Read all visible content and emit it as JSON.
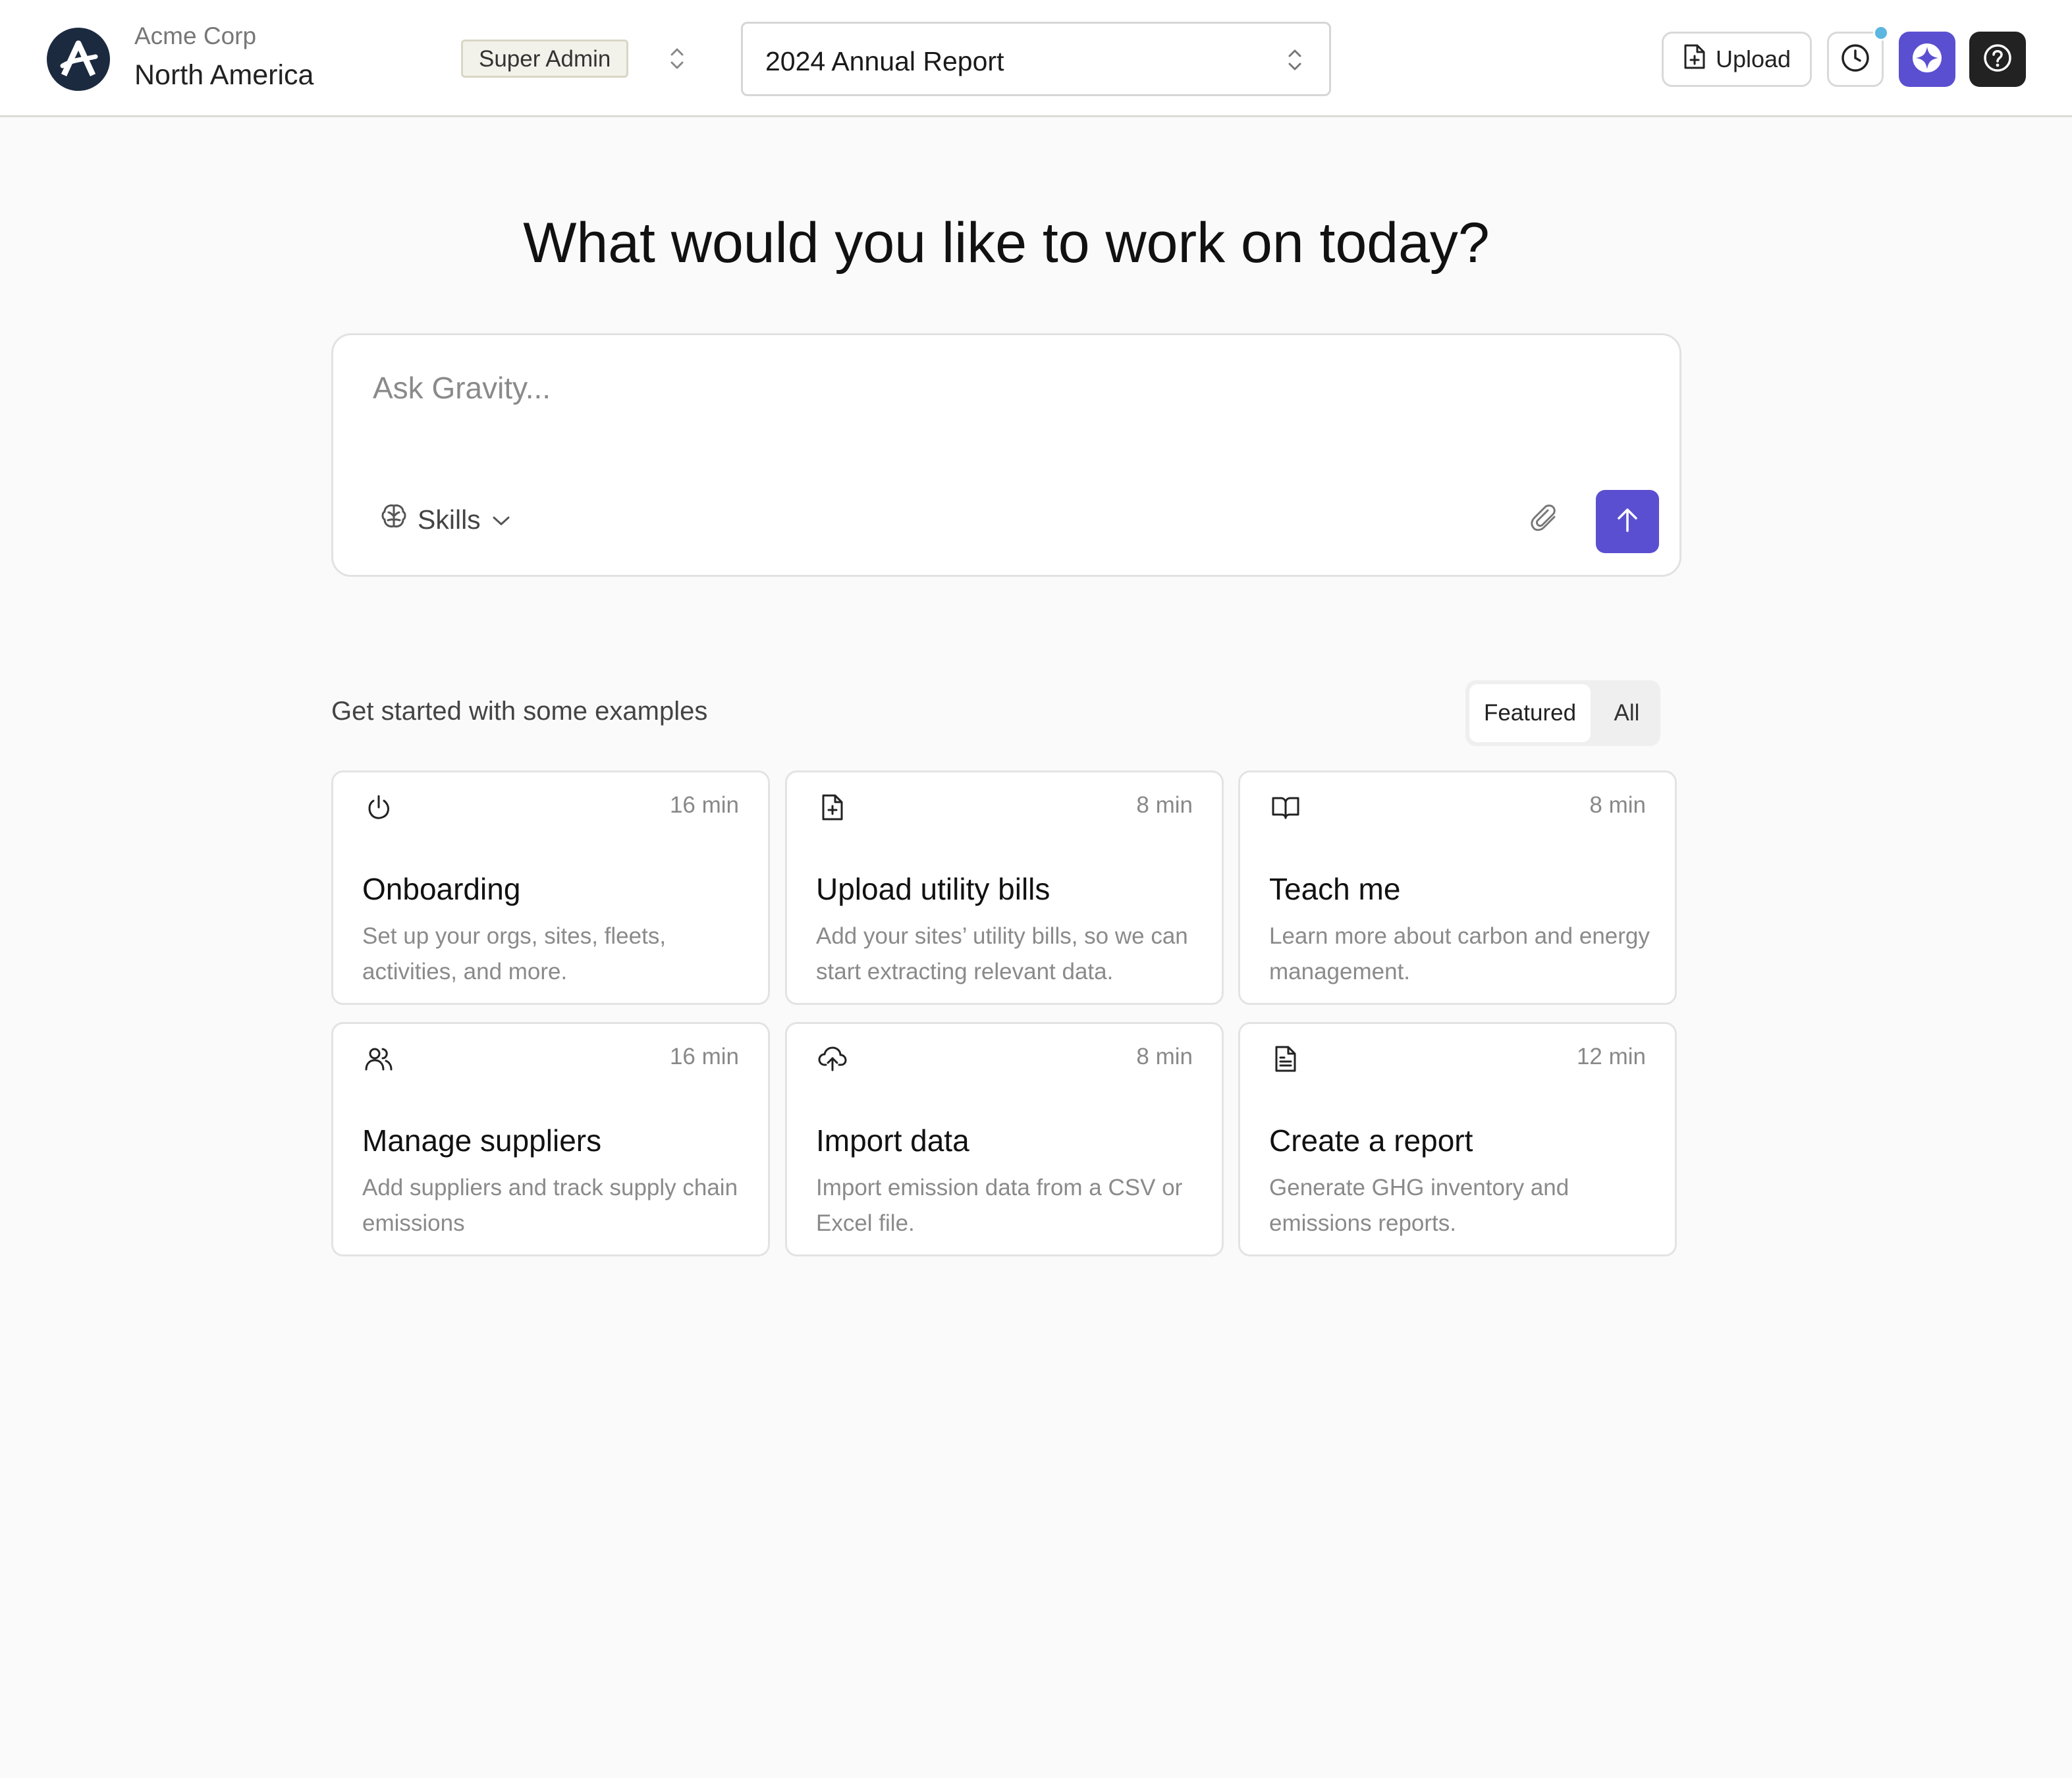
{
  "header": {
    "org_name": "Acme Corp",
    "region": "North America",
    "role": "Super Admin",
    "report": "2024 Annual Report",
    "upload_label": "Upload"
  },
  "main": {
    "headline": "What would you like to work on today?",
    "ask": {
      "placeholder": "Ask Gravity...",
      "skills_label": "Skills"
    },
    "examples": {
      "title": "Get started with some examples",
      "tabs": {
        "featured": "Featured",
        "all": "All",
        "active": "Featured"
      },
      "cards": [
        {
          "icon": "power-icon",
          "duration": "16 min",
          "title": "Onboarding",
          "description": "Set up your orgs, sites, fleets, activities, and more."
        },
        {
          "icon": "file-plus-icon",
          "duration": "8 min",
          "title": "Upload utility bills",
          "description": "Add your sites’ utility bills, so we can start extracting relevant data."
        },
        {
          "icon": "book-open-icon",
          "duration": "8 min",
          "title": "Teach me",
          "description": "Learn more about carbon and energy management."
        },
        {
          "icon": "users-icon",
          "duration": "16 min",
          "title": "Manage suppliers",
          "description": "Add suppliers and track supply chain emissions"
        },
        {
          "icon": "cloud-upload-icon",
          "duration": "8 min",
          "title": "Import data",
          "description": "Import emission data from a CSV or Excel file."
        },
        {
          "icon": "file-text-icon",
          "duration": "12 min",
          "title": "Create a report",
          "description": "Generate GHG inventory and emissions reports."
        }
      ]
    }
  },
  "colors": {
    "accent": "#5b4fd1",
    "logo_bg": "#1b2a3f",
    "notification_dot": "#5bb6e0",
    "help_bg": "#222222",
    "page_bg": "#fafafa"
  }
}
